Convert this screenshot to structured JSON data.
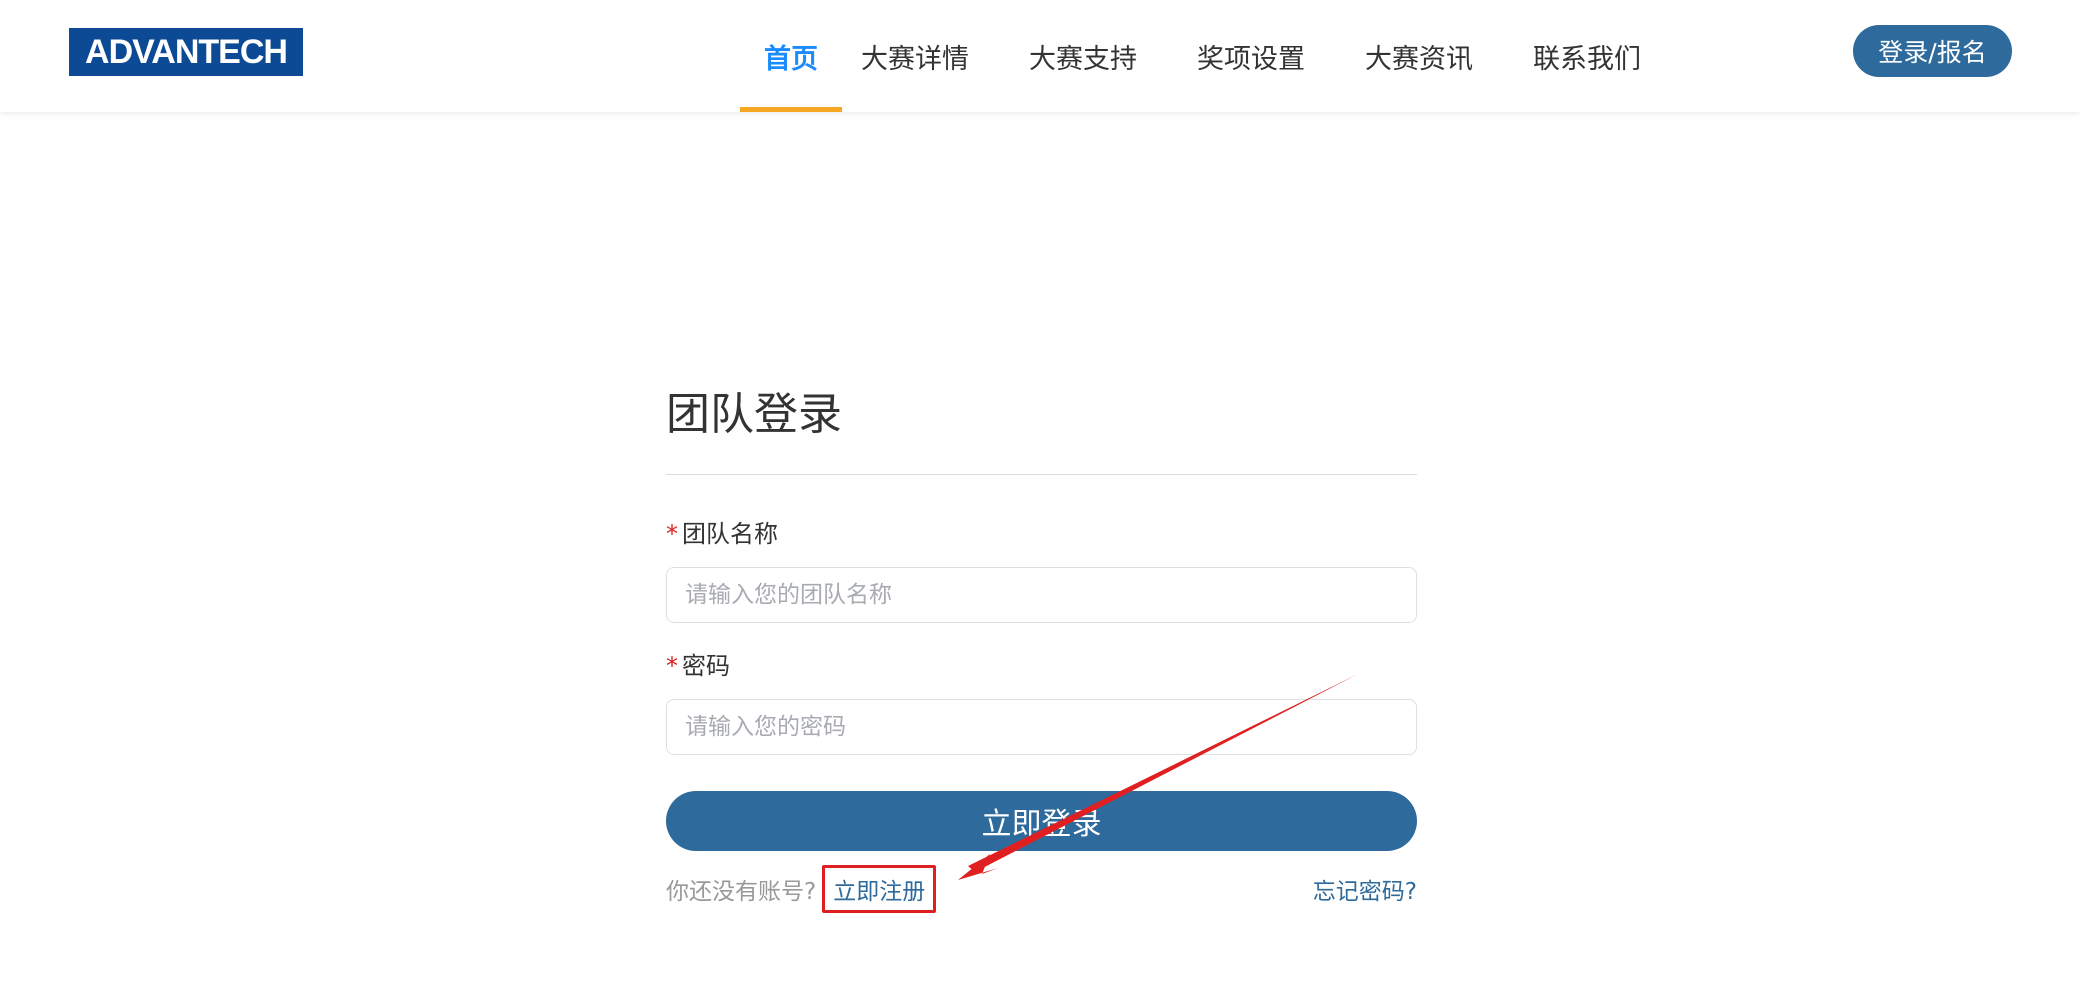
{
  "header": {
    "logo_text": "ADVANTECH",
    "nav": [
      {
        "label": "首页",
        "active": true
      },
      {
        "label": "大赛详情"
      },
      {
        "label": "大赛支持"
      },
      {
        "label": "奖项设置"
      },
      {
        "label": "大赛资讯"
      },
      {
        "label": "联系我们"
      }
    ],
    "login_label": "登录/报名"
  },
  "form": {
    "title": "团队登录",
    "team_label": "团队名称",
    "team_placeholder": "请输入您的团队名称",
    "password_label": "密码",
    "password_placeholder": "请输入您的密码",
    "required_mark": "*",
    "submit_label": "立即登录",
    "no_account_text": "你还没有账号?",
    "register_label": "立即注册",
    "forgot_label": "忘记密码?"
  },
  "colors": {
    "accent": "#1a8cff",
    "primary_button": "#2e6a9c",
    "active_underline": "#f5a623",
    "annotation": "#e02020"
  }
}
